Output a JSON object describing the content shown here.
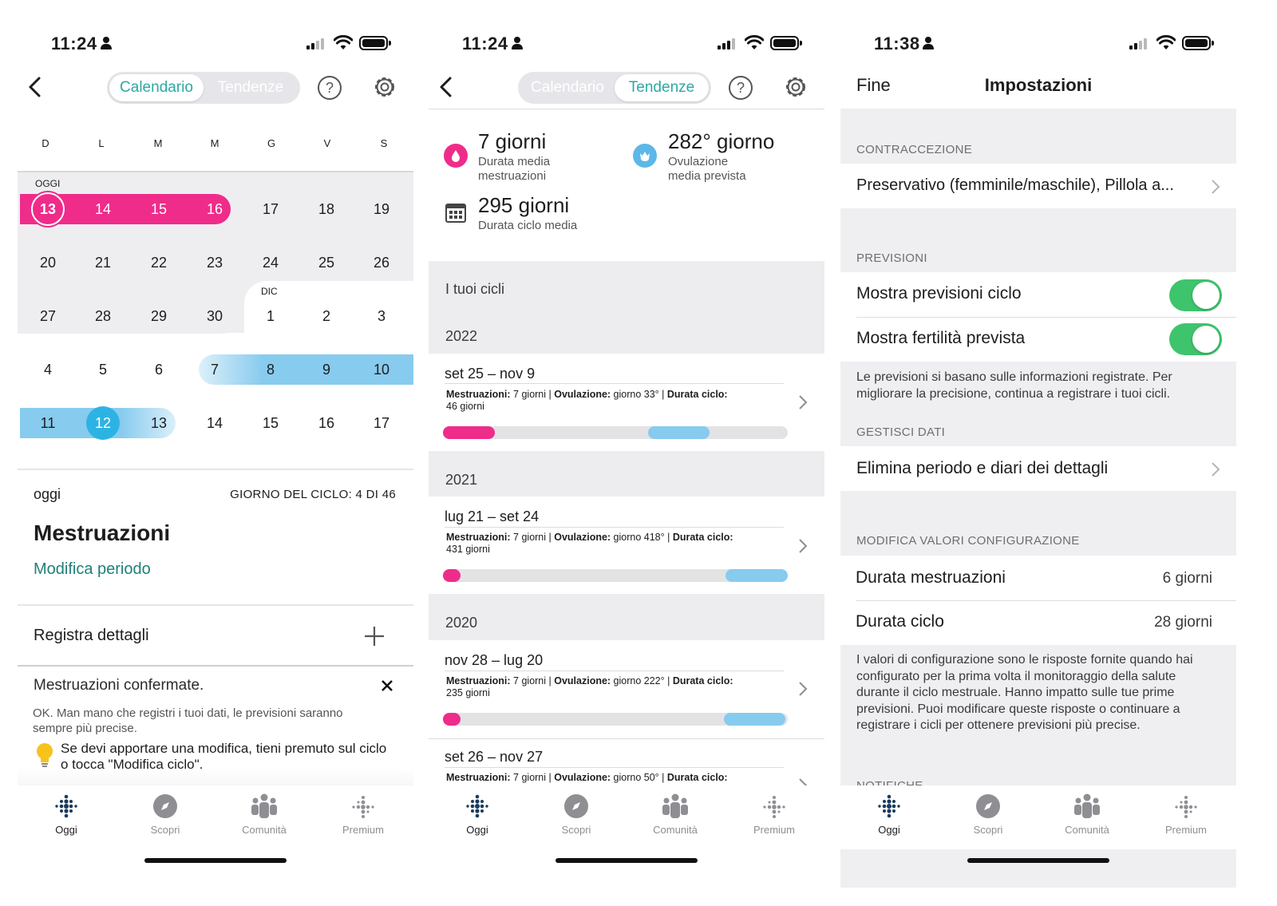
{
  "screen1": {
    "status": {
      "time": "11:24"
    },
    "segment": {
      "left": "Calendario",
      "right": "Tendenze",
      "active": "Calendario"
    },
    "help_glyph": "?",
    "weekdays": [
      "D",
      "L",
      "M",
      "M",
      "G",
      "V",
      "S"
    ],
    "today_tag": "OGGI",
    "month_tag": "DIC",
    "weeks": [
      [
        "13",
        "14",
        "15",
        "16",
        "17",
        "18",
        "19"
      ],
      [
        "20",
        "21",
        "22",
        "23",
        "24",
        "25",
        "26"
      ],
      [
        "27",
        "28",
        "29",
        "30",
        "1",
        "2",
        "3"
      ],
      [
        "4",
        "5",
        "6",
        "7",
        "8",
        "9",
        "10"
      ],
      [
        "11",
        "12",
        "13",
        "14",
        "15",
        "16",
        "17"
      ]
    ],
    "today_label": "oggi",
    "cycle_day": "GIORNO DEL CICLO: 4 DI 46",
    "phase_title": "Mestruazioni",
    "edit_link": "Modifica periodo",
    "log_details": "Registra dettagli",
    "toast": {
      "title": "Mestruazioni confermate.",
      "body": "OK. Man mano che registri i tuoi dati, le previsioni saranno sempre più precise.",
      "tip": "Se devi apportare una modifica, tieni premuto sul ciclo o tocca \"Modifica ciclo\"."
    },
    "colors": {
      "menstruation": "#ef2c8a",
      "fertile": "#87cbee",
      "accent": "#2ca9a2"
    }
  },
  "screen2": {
    "status": {
      "time": "11:24"
    },
    "segment": {
      "left": "Calendario",
      "right": "Tendenze",
      "active": "Tendenze"
    },
    "help_glyph": "?",
    "stats": {
      "period_big": "7 giorni",
      "period_sub1": "Durata media",
      "period_sub2": "mestruazioni",
      "ovulation_big": "282° giorno",
      "ovulation_sub1": "Ovulazione",
      "ovulation_sub2": "media prevista",
      "cycle_big": "295 giorni",
      "cycle_sub": "Durata ciclo media"
    },
    "cycles_header": "I tuoi cicli",
    "groups": [
      {
        "year": "2022",
        "range": "set 25 – nov 9",
        "meta_a": "Mestruazioni:",
        "meta_a_val": " 7 giorni  |  ",
        "meta_b": "Ovulazione:",
        "meta_b_val": " giorno 33°  |  ",
        "meta_c": "Durata ciclo:",
        "meta_c_val": "46 giorni",
        "period_fraction": 0.15,
        "ovulation_fraction": 0.72
      },
      {
        "year": "2021",
        "range": "lug 21 – set 24",
        "meta_a": "Mestruazioni:",
        "meta_a_val": " 7 giorni  |  ",
        "meta_b": "Ovulazione:",
        "meta_b_val": " giorno 418°  |  ",
        "meta_c": "Durata ciclo:",
        "meta_c_val": "431 giorni",
        "period_fraction": 0.02,
        "ovulation_fraction": 0.97
      },
      {
        "year": "2020",
        "range": "nov 28 – lug 20",
        "meta_a": "Mestruazioni:",
        "meta_a_val": " 7 giorni  |  ",
        "meta_b": "Ovulazione:",
        "meta_b_val": " giorno 222°  |  ",
        "meta_c": "Durata ciclo:",
        "meta_c_val": "235 giorni",
        "period_fraction": 0.03,
        "ovulation_fraction": 0.94
      }
    ],
    "extra": {
      "range": "set 26 – nov 27",
      "meta_a": "Mestruazioni:",
      "meta_a_val": " 7 giorni  |  ",
      "meta_b": "Ovulazione:",
      "meta_b_val": " giorno 50°  |  ",
      "meta_c": "Durata ciclo:"
    }
  },
  "screen3": {
    "status": {
      "time": "11:38"
    },
    "done": "Fine",
    "title": "Impostazioni",
    "contraception_hdr": "CONTRACCEZIONE",
    "contraception_val": "Preservativo (femminile/maschile), Pillola a...",
    "predictions_hdr": "PREVISIONI",
    "show_cycle": "Mostra previsioni ciclo",
    "show_fertility": "Mostra fertilità prevista",
    "show_cycle_on": true,
    "show_fertility_on": true,
    "predictions_note": "Le previsioni si basano sulle informazioni registrate. Per migliorare la precisione, continua a registrare i tuoi cicli.",
    "manage_hdr": "GESTISCI DATI",
    "delete_row": "Elimina periodo e diari dei dettagli",
    "config_hdr": "MODIFICA VALORI CONFIGURAZIONE",
    "period_len_label": "Durata mestruazioni",
    "period_len_val": "6 giorni",
    "cycle_len_label": "Durata ciclo",
    "cycle_len_val": "28 giorni",
    "config_note": "I valori di configurazione sono le risposte fornite quando hai configurato per la prima volta il monitoraggio della salute durante il ciclo mestruale. Hanno impatto sulle tue prime previsioni. Puoi modificare queste risposte o continuare a registrare i cicli per ottenere previsioni più precise.",
    "notifications_hdr": "NOTIFICHE"
  },
  "tabs": [
    "Oggi",
    "Scopri",
    "Comunità",
    "Premium"
  ]
}
